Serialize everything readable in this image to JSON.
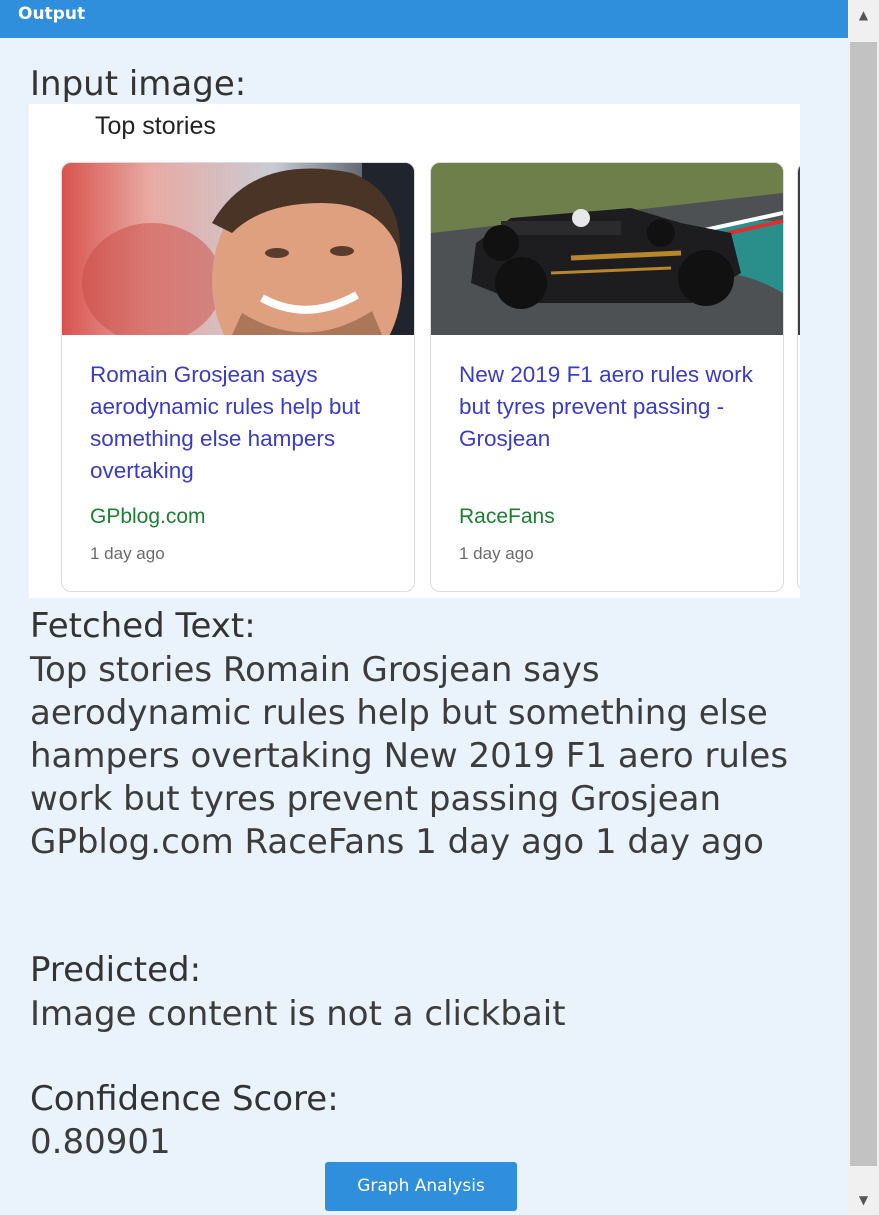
{
  "panel": {
    "title": "Output"
  },
  "input_image": {
    "label": "Input image:",
    "heading": "Top stories",
    "cards": [
      {
        "headline": "Romain Grosjean says aerodynamic rules help but something else hampers overtaking",
        "source": "GPblog.com",
        "time": "1 day ago",
        "image": "driver-portrait"
      },
      {
        "headline": "New 2019 F1 aero rules work but tyres prevent passing - Grosjean",
        "source": "RaceFans",
        "time": "1 day ago",
        "image": "f1-car"
      }
    ]
  },
  "fetched": {
    "label": "Fetched Text:",
    "text": "Top stories Romain Grosjean says aerodynamic rules help but something else hampers overtaking New 2019 F1 aero rules work but tyres prevent passing Grosjean GPblog.com RaceFans 1 day ago 1 day ago"
  },
  "predicted": {
    "label": "Predicted:",
    "value": "Image content is not a clickbait"
  },
  "confidence": {
    "label": "Confidence Score:",
    "value": "0.80901"
  },
  "actions": {
    "graph_button": "Graph Analysis"
  },
  "colors": {
    "header": "#2f8fdc",
    "background": "#eaf2fb",
    "link": "#3b3bc4",
    "source": "#1e7e34"
  }
}
